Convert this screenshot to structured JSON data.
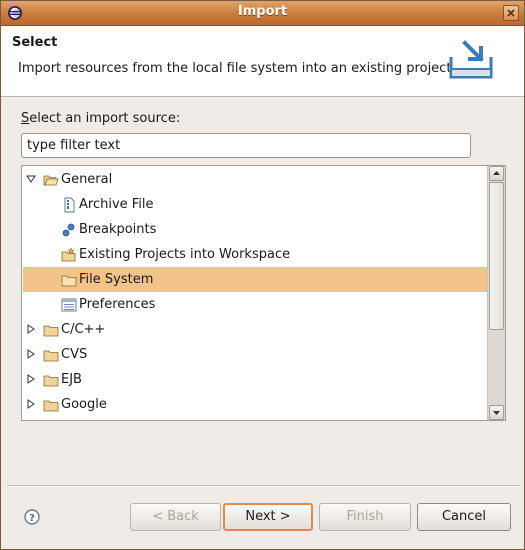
{
  "window": {
    "title": "Import"
  },
  "banner": {
    "title": "Select",
    "description": "Import resources from the local file system into an existing project."
  },
  "source": {
    "label": "Select an import source:",
    "filter_value": "type filter text"
  },
  "tree": {
    "items": [
      {
        "label": "General",
        "level": 0,
        "expanded": true,
        "icon": "folder-open-icon"
      },
      {
        "label": "Archive File",
        "level": 1,
        "icon": "archive-file-icon"
      },
      {
        "label": "Breakpoints",
        "level": 1,
        "icon": "breakpoints-icon"
      },
      {
        "label": "Existing Projects into Workspace",
        "level": 1,
        "icon": "existing-projects-icon"
      },
      {
        "label": "File System",
        "level": 1,
        "selected": true,
        "icon": "folder-icon"
      },
      {
        "label": "Preferences",
        "level": 1,
        "icon": "preferences-icon"
      },
      {
        "label": "C/C++",
        "level": 0,
        "expanded": false,
        "icon": "folder-icon"
      },
      {
        "label": "CVS",
        "level": 0,
        "expanded": false,
        "icon": "folder-icon"
      },
      {
        "label": "EJB",
        "level": 0,
        "expanded": false,
        "icon": "folder-icon"
      },
      {
        "label": "Google",
        "level": 0,
        "expanded": false,
        "icon": "folder-icon"
      }
    ]
  },
  "buttons": {
    "back": "< Back",
    "next": "Next >",
    "finish": "Finish",
    "cancel": "Cancel"
  },
  "colors": {
    "titlebar": "#c97a3e",
    "selection": "#f4c389",
    "default_button_border": "#e08a52"
  }
}
